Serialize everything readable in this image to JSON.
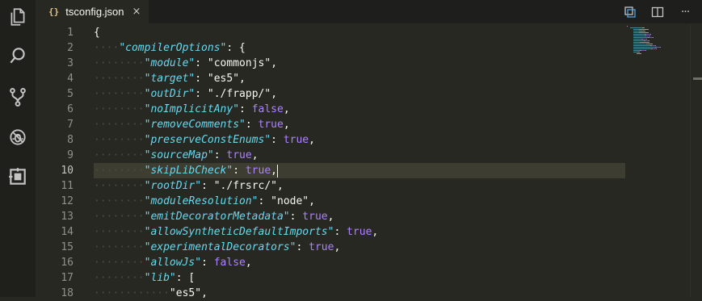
{
  "activity_bar": {
    "icons": [
      "explorer-icon",
      "search-icon",
      "source-control-icon",
      "debug-icon",
      "extensions-icon"
    ]
  },
  "tab": {
    "icon": "{}",
    "label": "tsconfig.json",
    "close": "×"
  },
  "editor_actions": {
    "icons": [
      "open-changes-icon",
      "split-editor-icon",
      "more-actions-icon"
    ],
    "more": "···"
  },
  "editor": {
    "active_line": 10,
    "lines": [
      {
        "n": "1",
        "tokens": [
          {
            "t": "{",
            "c": "pun"
          }
        ]
      },
      {
        "n": "2",
        "tokens": [
          {
            "t": "\"compilerOptions\"",
            "c": "key"
          },
          {
            "t": ": {",
            "c": "pun"
          }
        ]
      },
      {
        "n": "3",
        "tokens": [
          {
            "t": "\"module\"",
            "c": "key"
          },
          {
            "t": ": ",
            "c": "pun"
          },
          {
            "t": "\"commonjs\"",
            "c": "pun"
          },
          {
            "t": ",",
            "c": "pun"
          }
        ]
      },
      {
        "n": "4",
        "tokens": [
          {
            "t": "\"target\"",
            "c": "key"
          },
          {
            "t": ": ",
            "c": "pun"
          },
          {
            "t": "\"es5\"",
            "c": "pun"
          },
          {
            "t": ",",
            "c": "pun"
          }
        ]
      },
      {
        "n": "5",
        "tokens": [
          {
            "t": "\"outDir\"",
            "c": "key"
          },
          {
            "t": ": ",
            "c": "pun"
          },
          {
            "t": "\"./frapp/\"",
            "c": "pun"
          },
          {
            "t": ",",
            "c": "pun"
          }
        ]
      },
      {
        "n": "6",
        "tokens": [
          {
            "t": "\"noImplicitAny\"",
            "c": "key"
          },
          {
            "t": ": ",
            "c": "pun"
          },
          {
            "t": "false",
            "c": "kw"
          },
          {
            "t": ",",
            "c": "pun"
          }
        ]
      },
      {
        "n": "7",
        "tokens": [
          {
            "t": "\"removeComments\"",
            "c": "key"
          },
          {
            "t": ": ",
            "c": "pun"
          },
          {
            "t": "true",
            "c": "kw"
          },
          {
            "t": ",",
            "c": "pun"
          }
        ]
      },
      {
        "n": "8",
        "tokens": [
          {
            "t": "\"preserveConstEnums\"",
            "c": "key"
          },
          {
            "t": ": ",
            "c": "pun"
          },
          {
            "t": "true",
            "c": "kw"
          },
          {
            "t": ",",
            "c": "pun"
          }
        ]
      },
      {
        "n": "9",
        "tokens": [
          {
            "t": "\"sourceMap\"",
            "c": "key"
          },
          {
            "t": ": ",
            "c": "pun"
          },
          {
            "t": "true",
            "c": "kw"
          },
          {
            "t": ",",
            "c": "pun"
          }
        ]
      },
      {
        "n": "10",
        "tokens": [
          {
            "t": "\"skipLibCheck\"",
            "c": "key"
          },
          {
            "t": ": ",
            "c": "pun"
          },
          {
            "t": "true",
            "c": "kw"
          },
          {
            "t": ",",
            "c": "pun"
          }
        ]
      },
      {
        "n": "11",
        "tokens": [
          {
            "t": "\"rootDir\"",
            "c": "key"
          },
          {
            "t": ": ",
            "c": "pun"
          },
          {
            "t": "\"./frsrc/\"",
            "c": "pun"
          },
          {
            "t": ",",
            "c": "pun"
          }
        ]
      },
      {
        "n": "12",
        "tokens": [
          {
            "t": "\"moduleResolution\"",
            "c": "key"
          },
          {
            "t": ": ",
            "c": "pun"
          },
          {
            "t": "\"node\"",
            "c": "pun"
          },
          {
            "t": ",",
            "c": "pun"
          }
        ]
      },
      {
        "n": "13",
        "tokens": [
          {
            "t": "\"emitDecoratorMetadata\"",
            "c": "key"
          },
          {
            "t": ": ",
            "c": "pun"
          },
          {
            "t": "true",
            "c": "kw"
          },
          {
            "t": ",",
            "c": "pun"
          }
        ]
      },
      {
        "n": "14",
        "tokens": [
          {
            "t": "\"allowSyntheticDefaultImports\"",
            "c": "key"
          },
          {
            "t": ": ",
            "c": "pun"
          },
          {
            "t": "true",
            "c": "kw"
          },
          {
            "t": ",",
            "c": "pun"
          }
        ]
      },
      {
        "n": "15",
        "tokens": [
          {
            "t": "\"experimentalDecorators\"",
            "c": "key"
          },
          {
            "t": ": ",
            "c": "pun"
          },
          {
            "t": "true",
            "c": "kw"
          },
          {
            "t": ",",
            "c": "pun"
          }
        ]
      },
      {
        "n": "16",
        "tokens": [
          {
            "t": "\"allowJs\"",
            "c": "key"
          },
          {
            "t": ": ",
            "c": "pun"
          },
          {
            "t": "false",
            "c": "kw"
          },
          {
            "t": ",",
            "c": "pun"
          }
        ]
      },
      {
        "n": "17",
        "tokens": [
          {
            "t": "\"lib\"",
            "c": "key"
          },
          {
            "t": ": [",
            "c": "pun"
          }
        ]
      },
      {
        "n": "18",
        "tokens": [
          {
            "t": "\"es5\"",
            "c": "pun"
          },
          {
            "t": ",",
            "c": "pun"
          }
        ]
      }
    ],
    "indent_levels": [
      0,
      1,
      2,
      2,
      2,
      2,
      2,
      2,
      2,
      2,
      2,
      2,
      2,
      2,
      2,
      2,
      2,
      3
    ]
  },
  "colors": {
    "background": "#272822",
    "key": "#66d9ef",
    "keyword": "#ae81ff",
    "text": "#f8f8f2",
    "line_number": "#90908a",
    "current_line": "#3e3d32"
  }
}
